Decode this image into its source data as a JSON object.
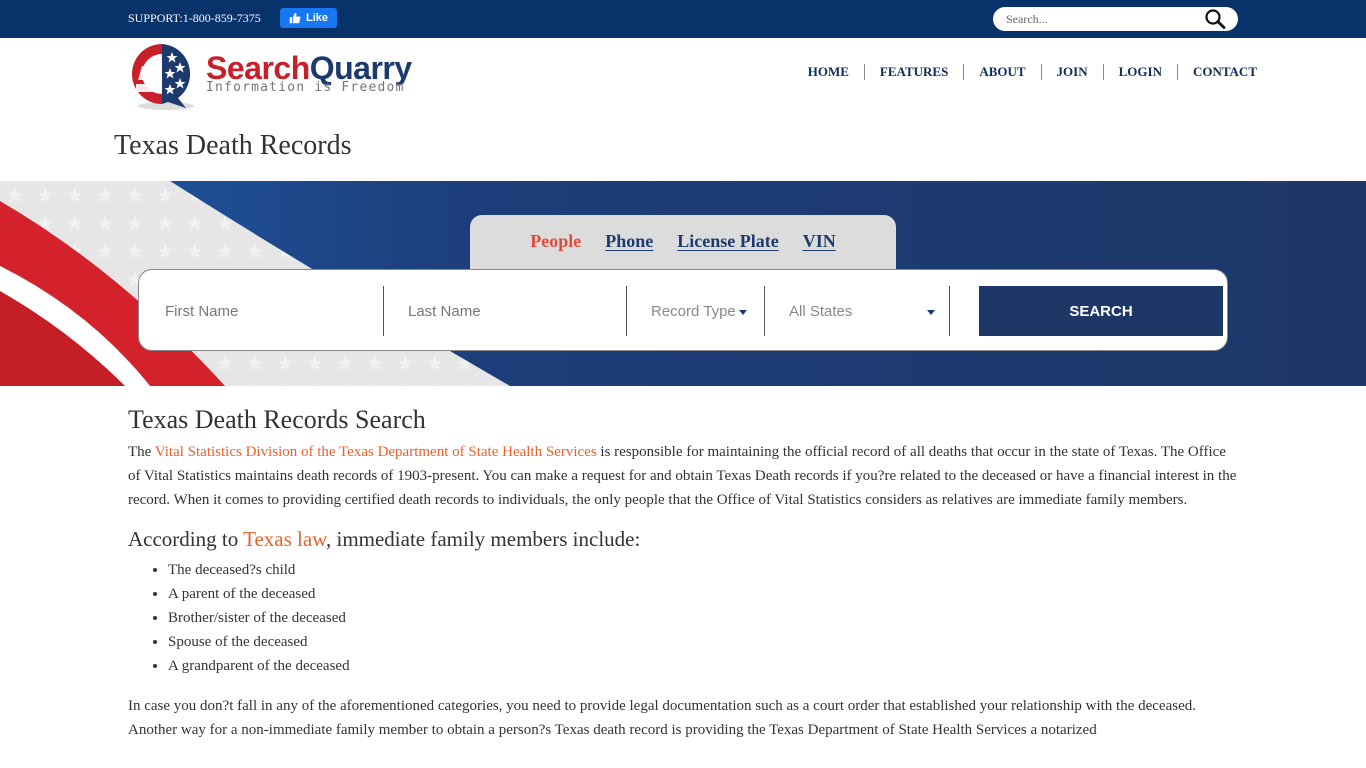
{
  "topbar": {
    "support": "SUPPORT:1-800-859-7375",
    "fb_like": "Like",
    "search_placeholder": "Search..."
  },
  "logo": {
    "name_part1": "Search",
    "name_part2": "Quarry",
    "tagline": "Information is Freedom"
  },
  "nav": {
    "items": [
      {
        "label": "HOME"
      },
      {
        "label": "FEATURES"
      },
      {
        "label": "ABOUT"
      },
      {
        "label": "JOIN"
      },
      {
        "label": "LOGIN"
      },
      {
        "label": "CONTACT"
      }
    ]
  },
  "page_title": "Texas Death Records",
  "search_tabs": [
    {
      "label": "People",
      "active": true
    },
    {
      "label": "Phone",
      "active": false
    },
    {
      "label": "License Plate",
      "active": false
    },
    {
      "label": "VIN",
      "active": false
    }
  ],
  "search_form": {
    "first_name_placeholder": "First Name",
    "last_name_placeholder": "Last Name",
    "record_type": "Record Type",
    "state": "All States",
    "submit": "SEARCH"
  },
  "colors": {
    "topbar": "#07326a",
    "navy": "#1d3767",
    "link_orange": "#e8622c",
    "active_tab": "#e04a3a",
    "flag_red": "#c8202a"
  },
  "content": {
    "heading": "Texas Death Records Search",
    "p1_before": "The ",
    "p1_link": "Vital Statistics Division of the Texas Department of State Health Services",
    "p1_after": " is responsible for maintaining the official record of all deaths that occur in the state of Texas. The Office of Vital Statistics maintains death records of 1903-present. You can make a request for and obtain Texas Death records if you?re related to the deceased or have a financial interest in the record. When it comes to providing certified death records to individuals, the only people that the Office of Vital Statistics considers as relatives are immediate family members.",
    "subheading_before": "According to ",
    "subheading_link": "Texas law",
    "subheading_after": ", immediate family members include:",
    "list": [
      "The deceased?s child",
      "A parent of the deceased",
      "Brother/sister of the deceased",
      "Spouse of the deceased",
      "A grandparent of the deceased"
    ],
    "p2": "In case you don?t fall in any of the aforementioned categories, you need to provide legal documentation such as a court order that established your relationship with the deceased. Another way for a non-immediate family member to obtain a person?s Texas death record is providing the Texas Department of State Health Services a notarized"
  }
}
